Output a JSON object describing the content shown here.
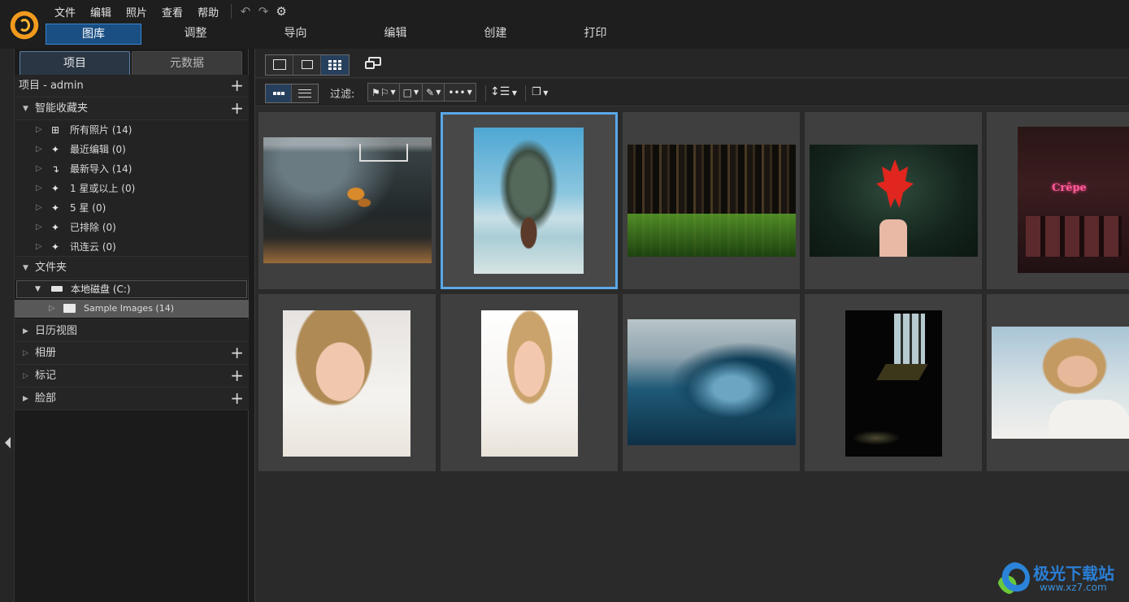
{
  "menubar": {
    "items": [
      "文件",
      "编辑",
      "照片",
      "查看",
      "帮助"
    ]
  },
  "toolbar_icons": [
    "undo-icon",
    "redo-icon",
    "settings-icon"
  ],
  "mode_tabs": [
    {
      "label": "图库",
      "active": true
    },
    {
      "label": "调整",
      "active": false
    },
    {
      "label": "导向",
      "active": false
    },
    {
      "label": "编辑",
      "active": false
    },
    {
      "label": "创建",
      "active": false
    },
    {
      "label": "打印",
      "active": false
    }
  ],
  "left_panel": {
    "tabs": [
      {
        "label": "项目",
        "active": true
      },
      {
        "label": "元数据",
        "active": false
      }
    ],
    "project": "项目 - admin",
    "smart_collections": {
      "label": "智能收藏夹",
      "items": [
        {
          "label": "所有照片 (14)",
          "icon": "hierarchy-icon"
        },
        {
          "label": "最近编辑 (0)",
          "icon": "magic-wand-icon"
        },
        {
          "label": "最新导入 (14)",
          "icon": "import-arrow-icon"
        },
        {
          "label": "1 星或以上 (0)",
          "icon": "magic-wand-icon"
        },
        {
          "label": "5 星 (0)",
          "icon": "magic-wand-icon"
        },
        {
          "label": "已排除 (0)",
          "icon": "magic-wand-icon"
        },
        {
          "label": "讯连云 (0)",
          "icon": "magic-wand-icon"
        }
      ]
    },
    "folders": {
      "label": "文件夹",
      "drive": "本地磁盘 (C:)",
      "folder": "Sample Images (14)"
    },
    "sections": [
      {
        "label": "日历视图",
        "has_plus": false
      },
      {
        "label": "相册",
        "has_plus": true
      },
      {
        "label": "标记",
        "has_plus": true
      },
      {
        "label": "脸部",
        "has_plus": true
      }
    ]
  },
  "view_toolbar": {
    "view_modes": [
      "single-view-icon",
      "compare-view-icon",
      "grid-view-icon"
    ],
    "active_view": "grid-view-icon"
  },
  "filter_toolbar": {
    "filter_label": "过滤:",
    "filters": [
      "flag-filter",
      "color-filter",
      "edit-filter",
      "more-filter"
    ],
    "sort": "sort-icon",
    "stack": "stack-icon"
  },
  "thumbnails": [
    {
      "subject": "basketball player dunk",
      "selected": false
    },
    {
      "subject": "rock island boat",
      "selected": true
    },
    {
      "subject": "forest",
      "selected": false
    },
    {
      "subject": "red maple leaf",
      "selected": false
    },
    {
      "subject": "cafe crepe neon",
      "selected": false
    },
    {
      "subject": "smiling woman",
      "selected": false
    },
    {
      "subject": "laughing woman",
      "selected": false
    },
    {
      "subject": "ocean wave",
      "selected": false
    },
    {
      "subject": "dark window light",
      "selected": false
    },
    {
      "subject": "woman portrait",
      "selected": false
    }
  ],
  "watermark": {
    "title": "极光下载站",
    "url": "www.xz7.com"
  }
}
